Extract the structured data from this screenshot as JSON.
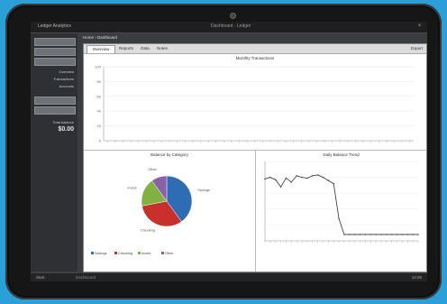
{
  "window": {
    "app_title": "Ledger Analytics",
    "center_text": "Dashboard · Ledger",
    "close_glyph": "×"
  },
  "sidebar": {
    "items": [
      "",
      "",
      ""
    ],
    "labels": [
      "Overview",
      "Transactions",
      "Accounts"
    ],
    "buttons": [
      "",
      ""
    ],
    "total_label": "Total balance",
    "total_value": "$0.00"
  },
  "breadcrumb": "Home › Dashboard",
  "tabs": {
    "items": [
      "Overview",
      "Reports",
      "Data",
      "Notes"
    ],
    "active": 0,
    "right": "Export"
  },
  "bar_chart": {
    "title": "Monthly Transactions",
    "ylim": [
      0,
      100
    ],
    "yticks": [
      0,
      20,
      40,
      60,
      80,
      100
    ]
  },
  "pie_chart": {
    "title": "Balance by Category",
    "slices": [
      {
        "label": "Savings",
        "value": 40,
        "color": "#2e6db4"
      },
      {
        "label": "Checking",
        "value": 32,
        "color": "#c8302c"
      },
      {
        "label": "Invest",
        "value": 18,
        "color": "#7fb241"
      },
      {
        "label": "Other",
        "value": 10,
        "color": "#8a60a8"
      }
    ],
    "legend": [
      "Savings",
      "Checking",
      "Invest",
      "Other"
    ]
  },
  "line_chart": {
    "title": "Daily Balance Trend",
    "ylim": [
      0,
      100
    ]
  },
  "bottombar": {
    "left": "Start",
    "mid": "Dashboard",
    "right": "12:00"
  },
  "chart_data": [
    {
      "type": "bar",
      "title": "Monthly Transactions",
      "categories": [
        "1",
        "2",
        "3",
        "4",
        "5",
        "6",
        "7",
        "8",
        "9",
        "10",
        "11",
        "12",
        "13",
        "14",
        "15",
        "16",
        "17",
        "18",
        "19",
        "20",
        "21",
        "22",
        "23",
        "24",
        "25",
        "26",
        "27",
        "28",
        "29",
        "30",
        "31",
        "32",
        "33",
        "34",
        "35",
        "36",
        "37",
        "38",
        "39",
        "40"
      ],
      "values": [
        0,
        0,
        0,
        0,
        0,
        0,
        0,
        0,
        0,
        0,
        0,
        0,
        0,
        0,
        0,
        0,
        0,
        0,
        0,
        0,
        0,
        0,
        0,
        0,
        0,
        0,
        0,
        0,
        0,
        0,
        0,
        0,
        0,
        0,
        0,
        0,
        0,
        0,
        0,
        0
      ],
      "ylim": [
        0,
        100
      ],
      "color": "#2e6db4"
    },
    {
      "type": "pie",
      "title": "Balance by Category",
      "labels": [
        "Savings",
        "Checking",
        "Invest",
        "Other"
      ],
      "values": [
        40,
        32,
        18,
        10
      ],
      "colors": [
        "#2e6db4",
        "#c8302c",
        "#7fb241",
        "#8a60a8"
      ]
    },
    {
      "type": "line",
      "title": "Daily Balance Trend",
      "x": [
        1,
        2,
        3,
        4,
        5,
        6,
        7,
        8,
        9,
        10,
        11,
        12,
        13,
        14,
        15,
        16,
        17,
        18,
        19,
        20,
        21,
        22,
        23,
        24,
        25,
        26,
        27,
        28,
        29,
        30
      ],
      "y": [
        78,
        80,
        77,
        68,
        79,
        74,
        82,
        80,
        79,
        82,
        83,
        80,
        76,
        72,
        28,
        8,
        8,
        8,
        8,
        8,
        8,
        8,
        8,
        8,
        8,
        8,
        8,
        8,
        8,
        8
      ],
      "ylim": [
        0,
        100
      ]
    }
  ]
}
